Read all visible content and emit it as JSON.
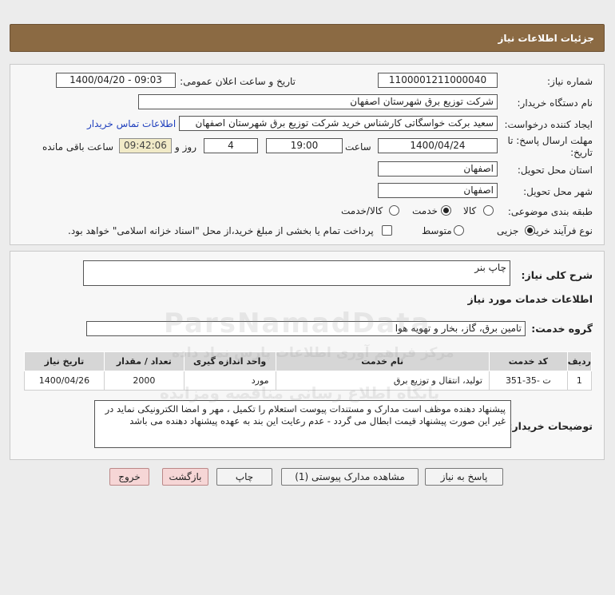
{
  "header": {
    "title": "جزئیات اطلاعات نیاز"
  },
  "need_info": {
    "need_number_label": "شماره نیاز:",
    "need_number": "1100001211000040",
    "announce_label": "تاریخ و ساعت اعلان عمومی:",
    "announce_value": "1400/04/20 - 09:03",
    "buyer_org_label": "نام دستگاه خریدار:",
    "buyer_org": "شرکت توزیع برق شهرستان اصفهان",
    "requester_label": "ایجاد کننده درخواست:",
    "requester": "سعید برکت خواسگاتی کارشناس خرید شرکت توزیع برق شهرستان اصفهان",
    "contact_link": "اطلاعات تماس خریدار",
    "deadline_label_1": "مهلت ارسال پاسخ: تا",
    "deadline_label_2": "تاریخ:",
    "deadline_date": "1400/04/24",
    "time_label": "ساعت",
    "deadline_time": "19:00",
    "days_value": "4",
    "days_label": "روز و",
    "remaining_time": "09:42:06",
    "remaining_label": "ساعت باقی مانده",
    "province_label": "استان محل تحویل:",
    "province": "اصفهان",
    "city_label": "شهر محل تحویل:",
    "city": "اصفهان",
    "category_label": "طبقه بندی موضوعی:",
    "category_options": [
      "کالا",
      "خدمت",
      "کالا/خدمت"
    ],
    "category_selected": "خدمت",
    "process_label": "نوع فرآیند خرید :",
    "process_options": [
      "جزیی",
      "متوسط"
    ],
    "process_selected": "جزیی",
    "payment_note": "پرداخت تمام یا بخشی از مبلغ خرید،از محل \"اسناد خزانه اسلامی\" خواهد بود."
  },
  "description": {
    "label": "شرح کلی نیاز:",
    "value": "چاپ بنر"
  },
  "services": {
    "section_title": "اطلاعات خدمات مورد نیاز",
    "group_label": "گروه خدمت:",
    "group_value": "تامین برق، گاز، بخار و تهویه هوا",
    "table_headers": [
      "ردیف",
      "کد خدمت",
      "نام خدمت",
      "واحد اندازه گیری",
      "تعداد / مقدار",
      "تاریخ نیاز"
    ],
    "rows": [
      [
        "1",
        "ت -35-351",
        "تولید، انتقال و توزیع برق",
        "مورد",
        "2000",
        "1400/04/26"
      ]
    ]
  },
  "buyer_notes": {
    "label": "توضیحات خریدار:",
    "text": "پیشنهاد دهنده موظف است مدارک و مستندات پیوست استعلام را تکمیل ، مهر و امضا الکترونیکی نماید در غیر این صورت پیشنهاد قیمت ابطال می گردد - عدم رعایت این بند به عهده پیشنهاد دهنده می باشد"
  },
  "buttons": {
    "reply": "پاسخ به نیاز",
    "attachments": "مشاهده مدارک پیوستی (1)",
    "print": "چاپ",
    "back": "بازگشت",
    "exit": "خروج"
  },
  "watermark": {
    "line1": "ParsNamadData",
    "line2": "مرکز فراهم آوری اطلاعات پارس نماد داده",
    "line3": "پایگاه اطلاع رسانی مناقصه ومزایده"
  }
}
